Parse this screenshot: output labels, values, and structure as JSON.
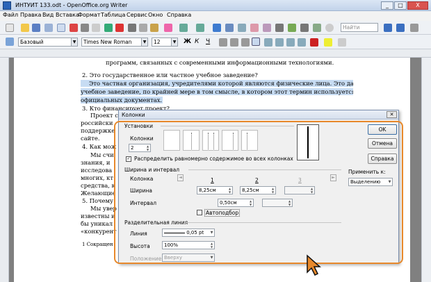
{
  "window": {
    "title": "ИНТУИТ 133.odt - OpenOffice.org Writer",
    "min": "_",
    "max": "□",
    "close": "X"
  },
  "menu": [
    "Файл",
    "Правка",
    "Вид",
    "Вставка",
    "Формат",
    "Таблица",
    "Сервис",
    "Окно",
    "Справка"
  ],
  "toolbar": {
    "find_placeholder": "Найти"
  },
  "format": {
    "style": "Базовый",
    "font": "Times New Roman",
    "size": "12",
    "bold": "Ж",
    "italic": "К",
    "underline": "Ч"
  },
  "doc": {
    "l0": "программ, связанных с современными информационными технологиями.",
    "l1": "2.  Это государственное или частное учебное заведение?",
    "l2": "Это частная организация, учредителями которой являются физические лица. Это даже не",
    "l3": "учебное заведение, по крайней мере в том смысле, в котором этот термин используется в",
    "l4": "официальных документах.",
    "l5": "3.  Кто финансирует проект?",
    "l6": "Проект с",
    "l7": "российски",
    "l8": "поддержке",
    "l9": "сайте.",
    "l10": "4.  Как мож",
    "l11": "Мы счи",
    "l12": "знания, и",
    "l13": "исследова",
    "l14": "многих, кт",
    "l15": "средства, к",
    "l16": "Желающие",
    "l17": "5.  Почему",
    "l18": "Мы увер",
    "l19": "известны и",
    "l20": "бы уникал",
    "l21": "«конкурент",
    "fn": "1   Сокращен"
  },
  "dialog": {
    "title": "Колонки",
    "settings": "Установки",
    "columns_label": "Колонки",
    "columns_value": "2",
    "distribute": "Распределить равномерно содержимое во всех колонках",
    "width_spacing": "Ширина и интервал",
    "column_label": "Колонка",
    "col1": "1",
    "col2": "2",
    "col3": "3",
    "width_label": "Ширина",
    "width1": "8,25см",
    "width2": "8,25см",
    "spacing_label": "Интервал",
    "spacing1": "0,50см",
    "autofit": "Автоподбор",
    "sep_line": "Разделительная линия",
    "line_label": "Линия",
    "line_value": "0,05 pt",
    "height_label": "Высота",
    "height_value": "100%",
    "position_label": "Положение",
    "position_value": "Вверху",
    "ok": "OK",
    "cancel": "Отмена",
    "help": "Справка",
    "apply_label": "Применить к:",
    "apply_value": "Выделению"
  },
  "colors": {
    "accent": "#e8892b",
    "selection": "#c7dcf3"
  }
}
